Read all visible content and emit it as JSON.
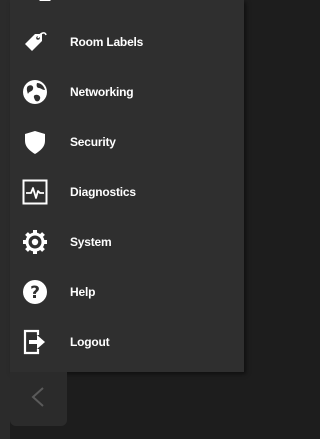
{
  "menu": {
    "items": [
      {
        "label": "Room Labels",
        "icon": "tag-icon"
      },
      {
        "label": "Networking",
        "icon": "globe-icon"
      },
      {
        "label": "Security",
        "icon": "shield-icon"
      },
      {
        "label": "Diagnostics",
        "icon": "pulse-icon"
      },
      {
        "label": "System",
        "icon": "gear-icon"
      },
      {
        "label": "Help",
        "icon": "help-icon"
      },
      {
        "label": "Logout",
        "icon": "logout-icon"
      }
    ]
  },
  "back": {
    "label": "<"
  },
  "colors": {
    "panel": "#2f2f2f",
    "background": "#1d1d1d",
    "text": "#ffffff"
  }
}
